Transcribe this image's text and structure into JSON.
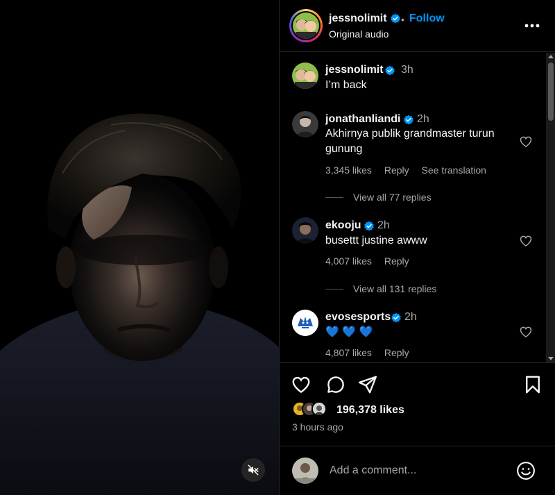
{
  "post": {
    "username": "jessnolimit",
    "separator": "•",
    "follow_label": "Follow",
    "audio_label": "Original audio",
    "more_icon": "more-horizontal-icon"
  },
  "media": {
    "mute_icon": "speaker-muted-icon"
  },
  "comments": [
    {
      "username": "jessnolimit",
      "time": "3h",
      "text": "I’m back"
    },
    {
      "username": "jonathanliandi",
      "time": "2h",
      "text": "Akhirnya publik grandmaster turun gunung",
      "likes": "3,345 likes",
      "reply_label": "Reply",
      "translate_label": "See translation",
      "view_replies": "View all 77 replies"
    },
    {
      "username": "ekooju",
      "time": "2h",
      "text": "busettt justine awww",
      "likes": "4,007 likes",
      "reply_label": "Reply",
      "view_replies": "View all 131 replies"
    },
    {
      "username": "evosesports",
      "time": "2h",
      "text": "💙 💙 💙",
      "likes": "4,807 likes",
      "reply_label": "Reply"
    }
  ],
  "actions": {
    "like_icon": "heart-icon",
    "comment_icon": "comment-bubble-icon",
    "share_icon": "send-paper-plane-icon",
    "save_icon": "bookmark-icon"
  },
  "stats": {
    "likes_text": "196,378 likes",
    "posted": "3 hours ago"
  },
  "add_comment": {
    "placeholder": "Add a comment...",
    "emoji_icon": "smiley-emoji-icon"
  },
  "colors": {
    "background": "#000000",
    "text": "#f5f5f5",
    "muted": "#a8a8a8",
    "accent": "#0095f6",
    "verified": "#0095f6",
    "divider": "#262626"
  }
}
